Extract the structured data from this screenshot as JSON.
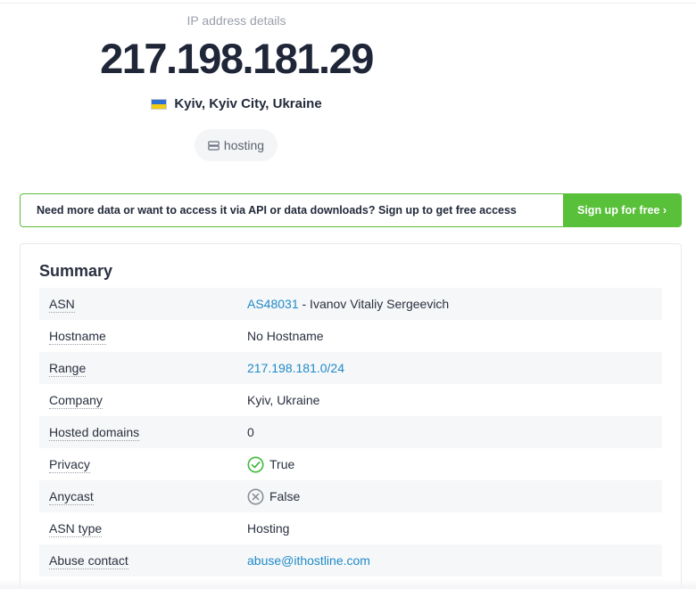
{
  "hero": {
    "subtitle": "IP address details",
    "ip": "217.198.181.29",
    "location": "Kyiv, Kyiv City, Ukraine",
    "flag_icon": "ukraine-flag-icon",
    "tag": "hosting",
    "tag_icon": "server-icon"
  },
  "banner": {
    "text": "Need more data or want to access it via API or data downloads? Sign up to get free access",
    "button": "Sign up for free ›",
    "accent": "#59c03a"
  },
  "summary": {
    "title": "Summary",
    "rows": {
      "asn": {
        "label": "ASN",
        "link": "AS48031",
        "rest": " - Ivanov Vitaliy Sergeevich"
      },
      "hostname": {
        "label": "Hostname",
        "value": "No Hostname"
      },
      "range": {
        "label": "Range",
        "value": "217.198.181.0/24"
      },
      "company": {
        "label": "Company",
        "value": "Kyiv, Ukraine"
      },
      "hosted": {
        "label": "Hosted domains",
        "value": "0"
      },
      "privacy": {
        "label": "Privacy",
        "value": "True",
        "icon": "check-circle-icon",
        "color": "#3fb83a"
      },
      "anycast": {
        "label": "Anycast",
        "value": "False",
        "icon": "x-circle-icon",
        "color": "#8a8f98"
      },
      "asn_type": {
        "label": "ASN type",
        "value": "Hosting"
      },
      "abuse": {
        "label": "Abuse contact",
        "value": "abuse@ithostline.com"
      }
    }
  },
  "link_color": "#1f8ac9"
}
